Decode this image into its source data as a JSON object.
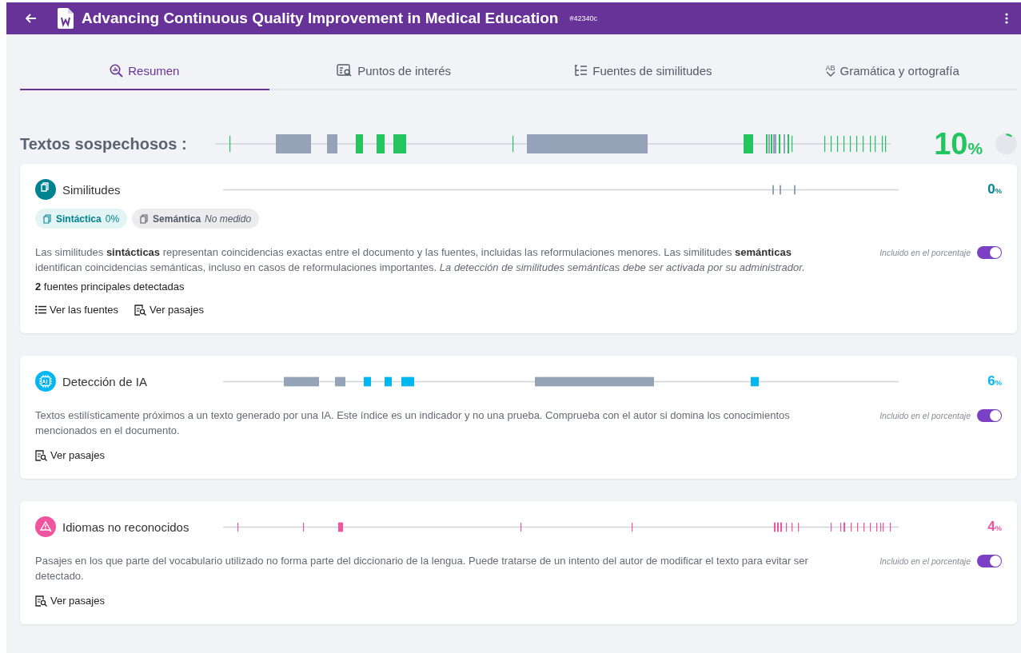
{
  "header": {
    "title": "Advancing Continuous Quality Improvement in Medical Education",
    "doc_id": "#42340c"
  },
  "tabs": [
    {
      "label": "Resumen",
      "kind": "report",
      "selected": true
    },
    {
      "label": "Puntos de interés",
      "kind": "points",
      "selected": false
    },
    {
      "label": "Fuentes de similitudes",
      "kind": "sources",
      "selected": false
    },
    {
      "label": "Gramática y ortografía",
      "kind": "grammar",
      "icon_text": "AB",
      "selected": false
    }
  ],
  "summary": {
    "label": "Textos sospechosos :",
    "value": "10",
    "unit": "%"
  },
  "sections": [
    {
      "kind": "similarity",
      "title": "Similitudes",
      "value": "0",
      "unit": "%",
      "color": "#00838f",
      "chips": [
        {
          "label": "Sintáctica",
          "value": "0%",
          "active": true
        },
        {
          "label": "Semántica",
          "value": "No medido",
          "active": false
        }
      ],
      "description": "Las similitudes **sintácticas** representan coincidencias exactas entre el documento y las fuentes, incluidas las reformulaciones menores. Las similitudes **semánticas** identifican coincidencias semánticas, incluso en casos de reformulaciones importantes. *La detección de similitudes semánticas debe ser activada por su administrador.*",
      "note": "**2** fuentes principales detectadas",
      "toggle": {
        "label": "Incluido en el porcentaje",
        "on": true
      },
      "links": [
        {
          "kind": "sources",
          "label": "Ver las fuentes"
        },
        {
          "kind": "passages",
          "label": "Ver pasajes"
        }
      ]
    },
    {
      "kind": "ai",
      "title": "Detección de IA",
      "value": "6",
      "unit": "%",
      "color": "#00b7f1",
      "description": "Textos estilísticamente próximos a un texto generado por una IA. Este índice es un indicador y no una prueba. Comprueba con el autor si domina los conocimientos mencionados en el documento.",
      "toggle": {
        "label": "Incluido en el porcentaje",
        "on": true
      },
      "links": [
        {
          "kind": "passages",
          "label": "Ver pasajes"
        }
      ]
    },
    {
      "kind": "language",
      "title": "Idiomas no reconocidos",
      "value": "4",
      "unit": "%",
      "color": "#f0549f",
      "description": "Pasajes en los que parte del vocabulario utilizado no forma parte del diccionario de la lengua. Puede tratarse de un intento del autor de modificar el texto para evitar ser detectado.",
      "toggle": {
        "label": "Incluido en el porcentaje",
        "on": true
      },
      "links": [
        {
          "kind": "passages",
          "label": "Ver pasajes"
        }
      ]
    }
  ]
}
